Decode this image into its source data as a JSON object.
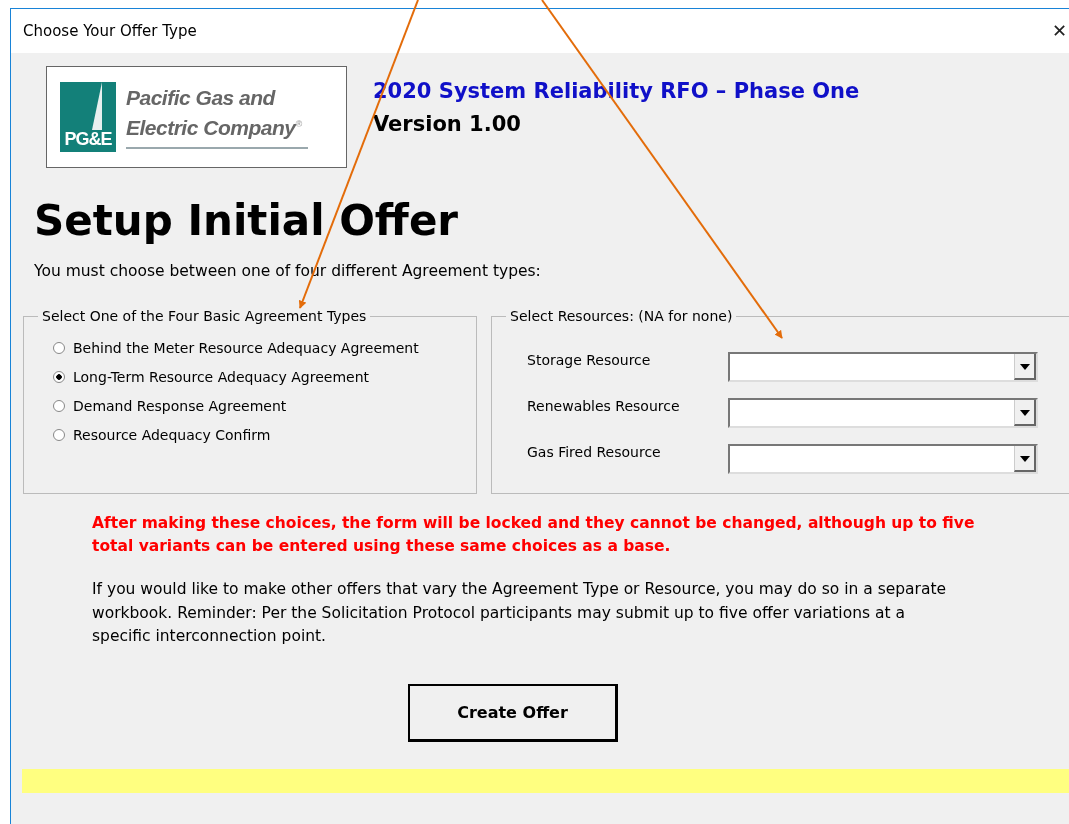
{
  "window": {
    "title": "Choose Your Offer Type",
    "close": "✕"
  },
  "logo": {
    "mark": "PG&E",
    "line_1": "Pacific Gas and",
    "line_2": "Electric Company",
    "registered": "®"
  },
  "header": {
    "title": "2020 System Reliability RFO – Phase One",
    "version": "Version 1.00"
  },
  "heading": "Setup Initial Offer",
  "intro": "You must choose between one of four different Agreement types:",
  "agreement_group": {
    "legend": "Select One of the Four Basic Agreement Types",
    "options": [
      {
        "label": "Behind the Meter Resource Adequacy Agreement",
        "selected": false
      },
      {
        "label": "Long-Term Resource Adequacy Agreement",
        "selected": true
      },
      {
        "label": "Demand Response Agreement",
        "selected": false
      },
      {
        "label": "Resource Adequacy Confirm",
        "selected": false
      }
    ]
  },
  "resource_group": {
    "legend": "Select Resources: (NA for none)",
    "fields": [
      {
        "label": "Storage Resource"
      },
      {
        "label": "Renewables Resource"
      },
      {
        "label": "Gas Fired Resource"
      }
    ]
  },
  "warning": "After making these choices, the form will be locked and they cannot be changed, although up to five total variants can be entered using these same choices as a base.",
  "note": "If you would like to make other offers that vary the Agreement Type or Resource, you may do so in a separate workbook. Reminder: Per the Solicitation Protocol participants may submit up to five offer variations at a specific interconnection point.",
  "button": "Create Offer"
}
